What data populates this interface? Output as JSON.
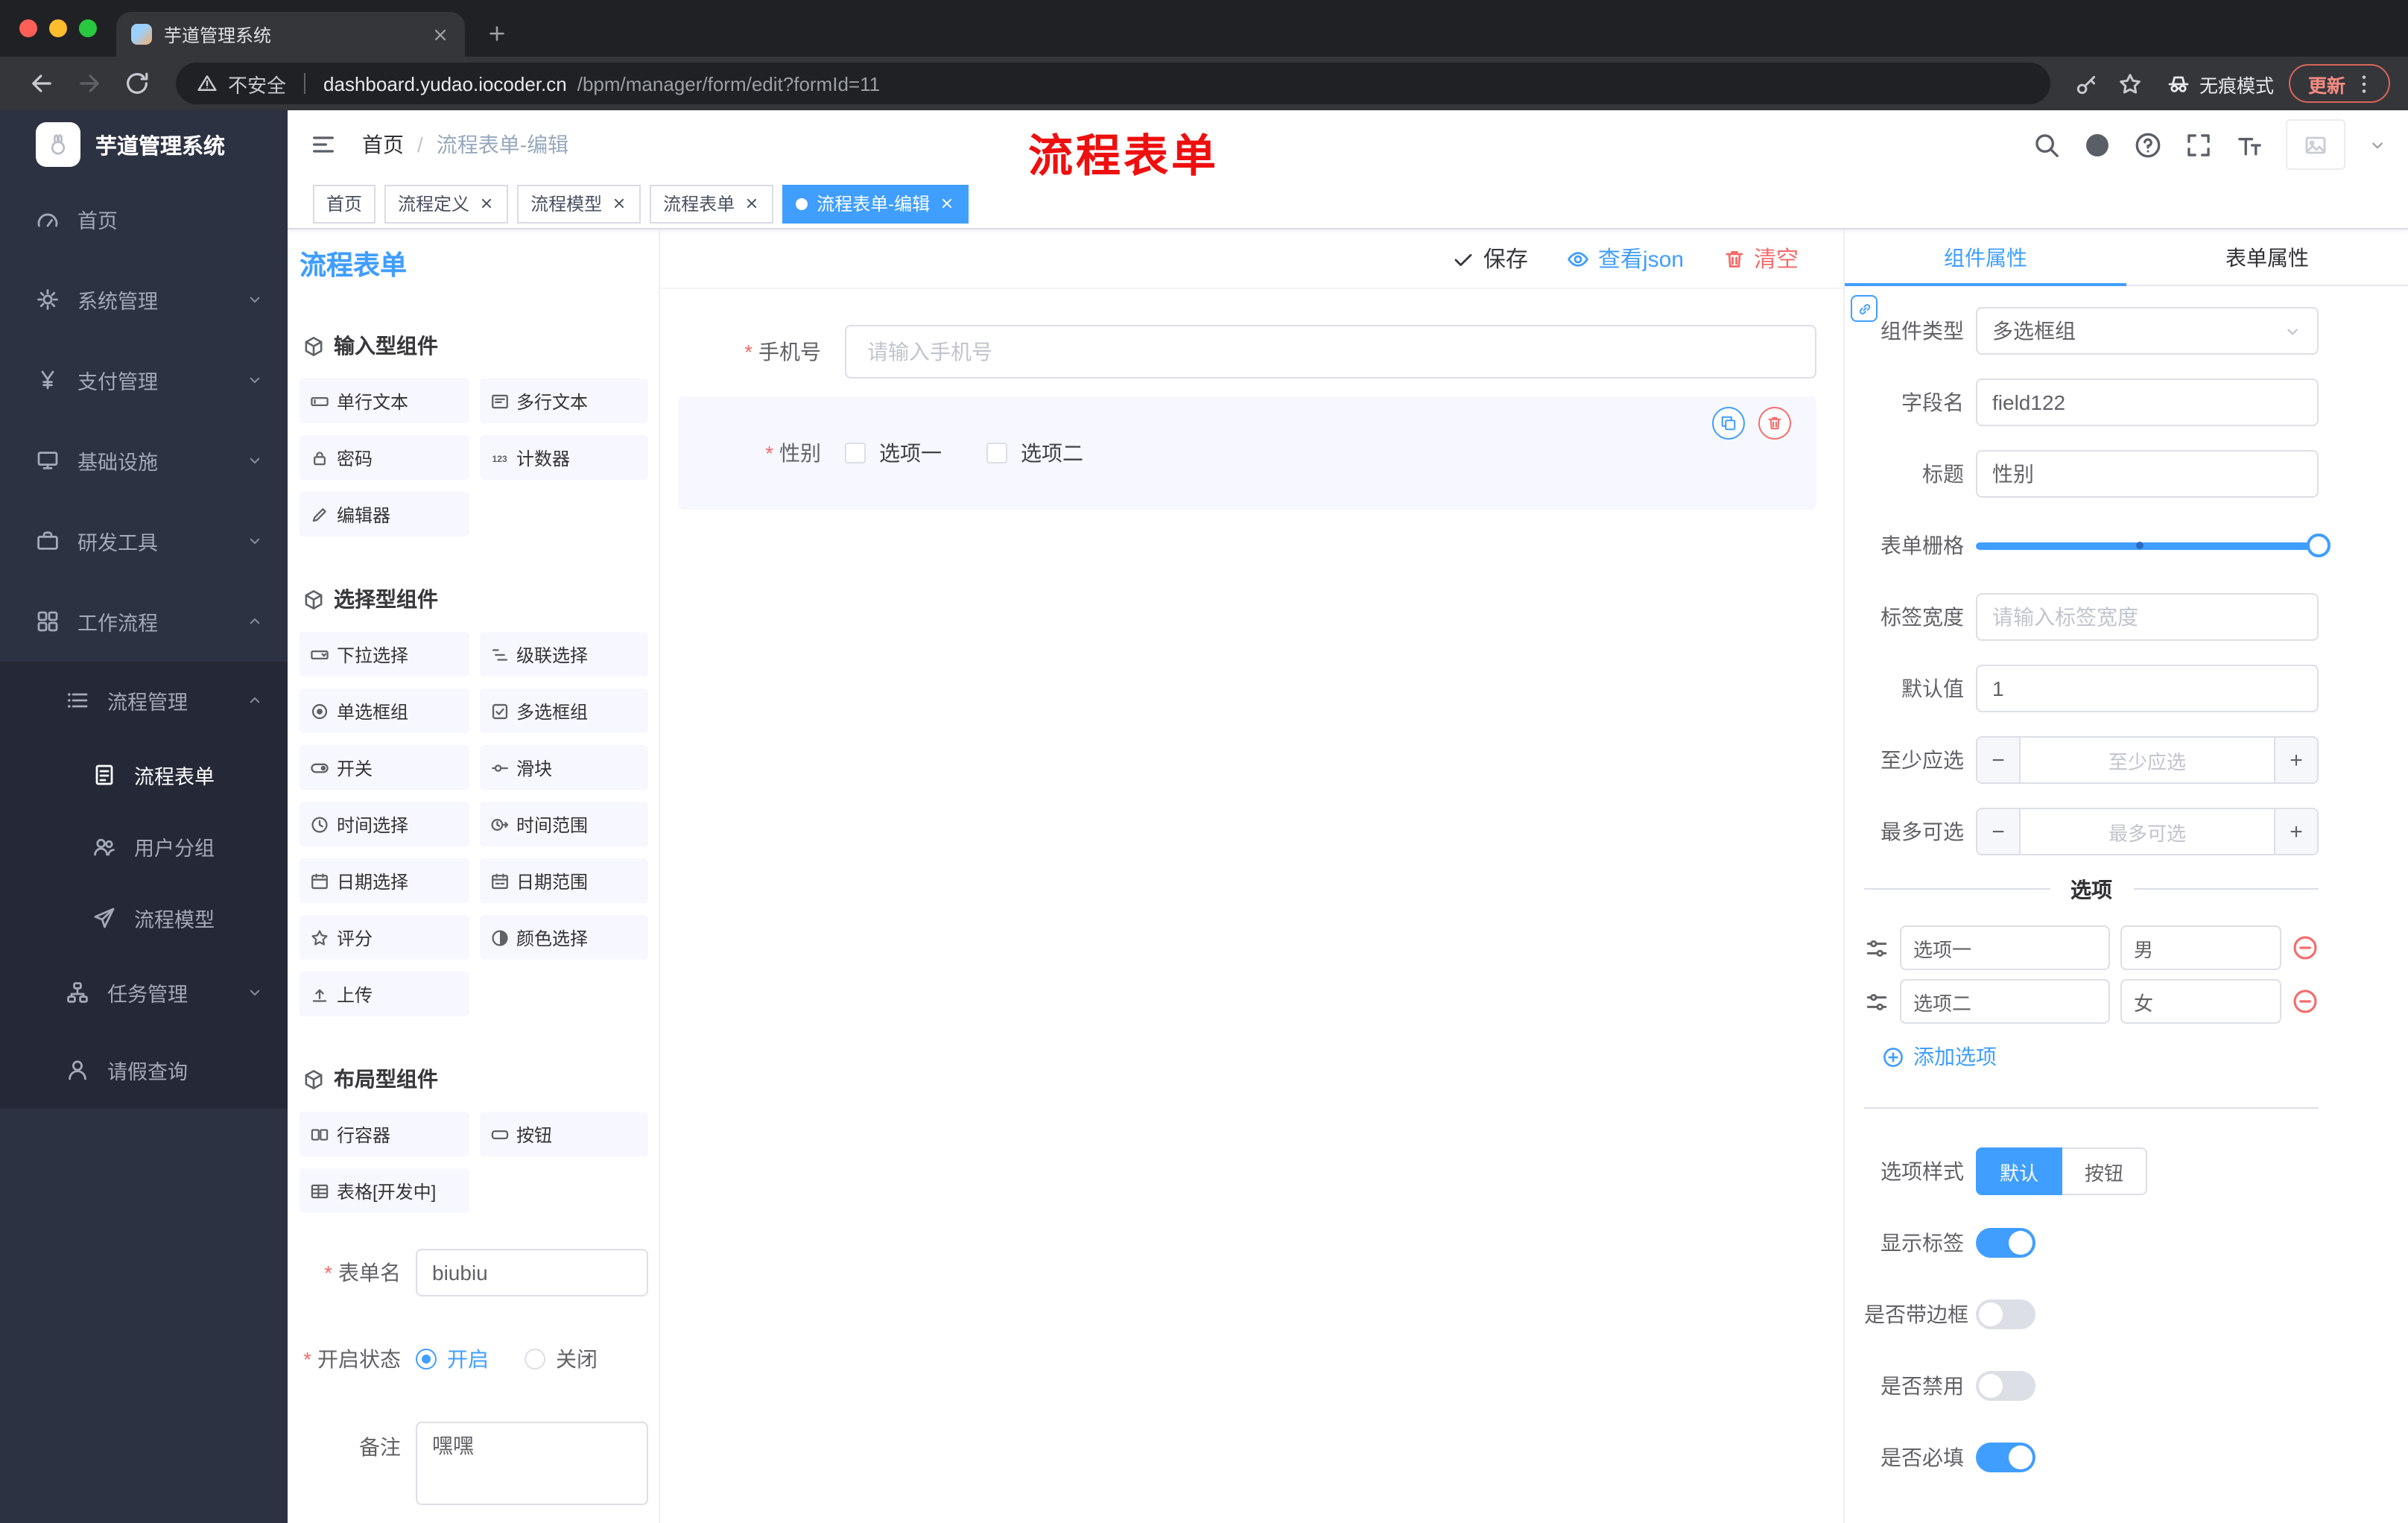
{
  "browser": {
    "tab_title": "芋道管理系统",
    "security_label": "不安全",
    "url_host": "dashboard.yudao.iocoder.cn",
    "url_path": "/bpm/manager/form/edit?formId=11",
    "incognito_label": "无痕模式",
    "update_label": "更新"
  },
  "sidebar": {
    "logo_title": "芋道管理系统",
    "items": [
      {
        "label": "首页",
        "icon": "dashboard-icon",
        "level": 1
      },
      {
        "label": "系统管理",
        "icon": "gear-icon",
        "level": 1,
        "chevron": "down"
      },
      {
        "label": "支付管理",
        "icon": "yen-icon",
        "level": 1,
        "chevron": "down"
      },
      {
        "label": "基础设施",
        "icon": "monitor-icon",
        "level": 1,
        "chevron": "down"
      },
      {
        "label": "研发工具",
        "icon": "briefcase-icon",
        "level": 1,
        "chevron": "down"
      },
      {
        "label": "工作流程",
        "icon": "grid-icon",
        "level": 1,
        "chevron": "up",
        "expanded": true
      },
      {
        "label": "流程管理",
        "icon": "list-icon",
        "level": 2,
        "chevron": "up",
        "expanded": true
      },
      {
        "label": "流程表单",
        "icon": "document-icon",
        "level": 3,
        "active": true
      },
      {
        "label": "用户分组",
        "icon": "user-group-icon",
        "level": 3
      },
      {
        "label": "流程模型",
        "icon": "paper-plane-icon",
        "level": 3
      },
      {
        "label": "任务管理",
        "icon": "org-tree-icon",
        "level": 2,
        "chevron": "down"
      },
      {
        "label": "请假查询",
        "icon": "person-icon",
        "level": 2
      }
    ]
  },
  "header": {
    "breadcrumb": [
      "首页",
      "流程表单-编辑"
    ],
    "annotation": "流程表单",
    "right_icons": [
      "search-icon",
      "github-icon",
      "question-icon",
      "fullscreen-icon",
      "font-size-icon"
    ]
  },
  "tags": [
    {
      "label": "首页",
      "active": false,
      "closable": false
    },
    {
      "label": "流程定义",
      "active": false,
      "closable": true
    },
    {
      "label": "流程模型",
      "active": false,
      "closable": true
    },
    {
      "label": "流程表单",
      "active": false,
      "closable": true
    },
    {
      "label": "流程表单-编辑",
      "active": true,
      "closable": true
    }
  ],
  "designer": {
    "panel_title": "流程表单",
    "toolbar": {
      "save": "保存",
      "view_json": "查看json",
      "clear": "清空"
    },
    "groups": [
      {
        "title": "输入型组件",
        "items": [
          {
            "label": "单行文本",
            "icon": "input-icon"
          },
          {
            "label": "多行文本",
            "icon": "textarea-icon"
          },
          {
            "label": "密码",
            "icon": "lock-icon"
          },
          {
            "label": "计数器",
            "icon": "counter-icon"
          },
          {
            "label": "编辑器",
            "icon": "editor-icon"
          }
        ]
      },
      {
        "title": "选择型组件",
        "items": [
          {
            "label": "下拉选择",
            "icon": "select-icon"
          },
          {
            "label": "级联选择",
            "icon": "cascader-icon"
          },
          {
            "label": "单选框组",
            "icon": "radio-icon"
          },
          {
            "label": "多选框组",
            "icon": "checkbox-icon"
          },
          {
            "label": "开关",
            "icon": "switch-icon"
          },
          {
            "label": "滑块",
            "icon": "slider-icon"
          },
          {
            "label": "时间选择",
            "icon": "clock-icon"
          },
          {
            "label": "时间范围",
            "icon": "clock-range-icon"
          },
          {
            "label": "日期选择",
            "icon": "calendar-icon"
          },
          {
            "label": "日期范围",
            "icon": "calendar-range-icon"
          },
          {
            "label": "评分",
            "icon": "star-icon"
          },
          {
            "label": "颜色选择",
            "icon": "color-icon"
          },
          {
            "label": "上传",
            "icon": "upload-icon"
          }
        ]
      },
      {
        "title": "布局型组件",
        "items": [
          {
            "label": "行容器",
            "icon": "row-container-icon"
          },
          {
            "label": "按钮",
            "icon": "button-icon"
          },
          {
            "label": "表格[开发中]",
            "icon": "table-icon"
          }
        ]
      }
    ],
    "meta": {
      "form_name_label": "表单名",
      "form_name_value": "biubiu",
      "status_label": "开启状态",
      "status_on": "开启",
      "status_off": "关闭",
      "status_selected": "开启",
      "remark_label": "备注",
      "remark_value": "嘿嘿"
    },
    "canvas": {
      "phone": {
        "label": "手机号",
        "required": true,
        "placeholder": "请输入手机号"
      },
      "gender": {
        "label": "性别",
        "required": true,
        "option1": "选项一",
        "option2": "选项二",
        "selected_component": true
      }
    }
  },
  "props": {
    "tabs": {
      "component": "组件属性",
      "form": "表单属性",
      "active": "组件属性"
    },
    "component_type_label": "组件类型",
    "component_type_value": "多选框组",
    "field_name_label": "字段名",
    "field_name_value": "field122",
    "title_label": "标题",
    "title_value": "性别",
    "grid_label": "表单栅格",
    "label_width_label": "标签宽度",
    "label_width_placeholder": "请输入标签宽度",
    "default_label": "默认值",
    "default_value": "1",
    "min_label": "至少应选",
    "min_placeholder": "至少应选",
    "max_label": "最多可选",
    "max_placeholder": "最多可选",
    "options_divider": "选项",
    "options": [
      {
        "name": "选项一",
        "value": "男"
      },
      {
        "name": "选项二",
        "value": "女"
      }
    ],
    "add_option": "添加选项",
    "option_style_label": "选项样式",
    "option_style_default": "默认",
    "option_style_button": "按钮",
    "option_style_selected": "默认",
    "toggles": [
      {
        "label": "显示标签",
        "on": true
      },
      {
        "label": "是否带边框",
        "on": false
      },
      {
        "label": "是否禁用",
        "on": false
      },
      {
        "label": "是否必填",
        "on": true
      }
    ]
  },
  "colors": {
    "accent": "#409eff",
    "danger": "#f56c6c",
    "annotation_red": "#ee0f0f",
    "sidebar_bg": "#2d3243",
    "sidebar_submenu_bg": "#252937",
    "chrome_bg": "#202124",
    "chrome_toolbar_bg": "#35363a"
  }
}
